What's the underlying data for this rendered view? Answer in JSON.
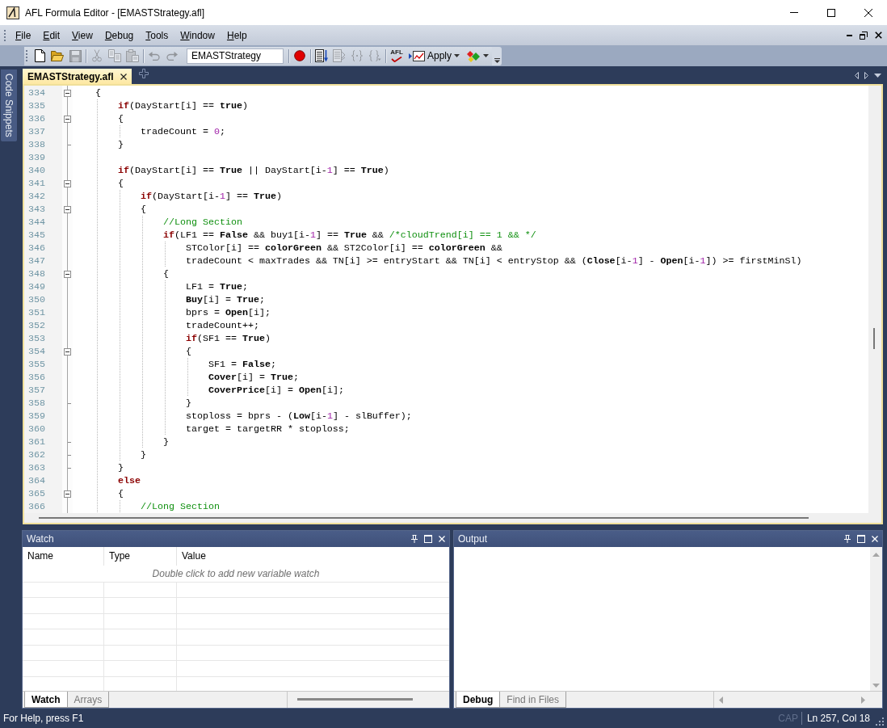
{
  "window": {
    "title": "AFL Formula Editor - [EMASTStrategy.afl]"
  },
  "menu": [
    {
      "label": "File"
    },
    {
      "label": "Edit"
    },
    {
      "label": "View"
    },
    {
      "label": "Debug"
    },
    {
      "label": "Tools"
    },
    {
      "label": "Window"
    },
    {
      "label": "Help"
    }
  ],
  "toolbar": {
    "items": [
      {
        "kind": "button",
        "disabled": false
      },
      {
        "kind": "button",
        "disabled": false
      },
      {
        "kind": "button",
        "disabled": true
      },
      {
        "kind": "separator"
      },
      {
        "kind": "button",
        "disabled": true
      },
      {
        "kind": "button",
        "disabled": true
      },
      {
        "kind": "button",
        "disabled": true
      },
      {
        "kind": "separator"
      },
      {
        "kind": "button",
        "disabled": true
      },
      {
        "kind": "button",
        "disabled": true
      },
      {
        "kind": "combo",
        "value": "EMASTStrategy"
      },
      {
        "kind": "separator"
      },
      {
        "kind": "button",
        "disabled": false
      },
      {
        "kind": "separator"
      },
      {
        "kind": "button",
        "disabled": false
      },
      {
        "kind": "button",
        "disabled": true
      },
      {
        "kind": "button",
        "disabled": true
      },
      {
        "kind": "button",
        "disabled": true
      },
      {
        "kind": "separator"
      },
      {
        "kind": "button",
        "label": "AFL",
        "disabled": false
      },
      {
        "kind": "split",
        "label": "Apply",
        "disabled": false
      },
      {
        "kind": "split",
        "disabled": false
      }
    ]
  },
  "side_tabs": [
    {
      "label": "Code Snippets"
    }
  ],
  "document_tabs": [
    {
      "label": "EMASTStrategy.afl",
      "selected": true
    }
  ],
  "editor": {
    "lines": [
      {
        "number": "334",
        "expanded": true,
        "tokens": [
          {
            "text": "{",
            "kind": "plain"
          }
        ],
        "children": [
          {
            "number": "335",
            "tokens": [
              {
                "text": "if",
                "kind": "keyword"
              },
              {
                "text": "(DayStart[i] == ",
                "kind": "plain"
              },
              {
                "text": "true",
                "kind": "builtin"
              },
              {
                "text": ")",
                "kind": "plain"
              }
            ]
          },
          {
            "number": "336",
            "expanded": true,
            "tokens": [
              {
                "text": "{",
                "kind": "plain"
              }
            ],
            "children": [
              {
                "number": "337",
                "tokens": [
                  {
                    "text": "tradeCount = ",
                    "kind": "plain"
                  },
                  {
                    "text": "0",
                    "kind": "number"
                  },
                  {
                    "text": ";",
                    "kind": "plain"
                  }
                ]
              }
            ]
          },
          {
            "number": "338",
            "fold_end": true,
            "tokens": [
              {
                "text": "}",
                "kind": "plain"
              }
            ]
          },
          {
            "number": "339"
          },
          {
            "number": "340",
            "tokens": [
              {
                "text": "if",
                "kind": "keyword"
              },
              {
                "text": "(DayStart[i] == ",
                "kind": "plain"
              },
              {
                "text": "True",
                "kind": "builtin"
              },
              {
                "text": " || DayStart[i-",
                "kind": "plain"
              },
              {
                "text": "1",
                "kind": "number"
              },
              {
                "text": "] == ",
                "kind": "plain"
              },
              {
                "text": "True",
                "kind": "builtin"
              },
              {
                "text": ")",
                "kind": "plain"
              }
            ]
          },
          {
            "number": "341",
            "expanded": true,
            "tokens": [
              {
                "text": "{",
                "kind": "plain"
              }
            ],
            "children": [
              {
                "number": "342",
                "tokens": [
                  {
                    "text": "if",
                    "kind": "keyword"
                  },
                  {
                    "text": "(DayStart[i-",
                    "kind": "plain"
                  },
                  {
                    "text": "1",
                    "kind": "number"
                  },
                  {
                    "text": "] == ",
                    "kind": "plain"
                  },
                  {
                    "text": "True",
                    "kind": "builtin"
                  },
                  {
                    "text": ")",
                    "kind": "plain"
                  }
                ]
              },
              {
                "number": "343",
                "expanded": true,
                "tokens": [
                  {
                    "text": "{",
                    "kind": "plain"
                  }
                ],
                "children": [
                  {
                    "number": "344",
                    "tokens": [
                      {
                        "text": "//Long Section",
                        "kind": "comment"
                      }
                    ]
                  },
                  {
                    "number": "345",
                    "tokens": [
                      {
                        "text": "if",
                        "kind": "keyword"
                      },
                      {
                        "text": "(LF1 == ",
                        "kind": "plain"
                      },
                      {
                        "text": "False",
                        "kind": "builtin"
                      },
                      {
                        "text": " && buy1[i-",
                        "kind": "plain"
                      },
                      {
                        "text": "1",
                        "kind": "number"
                      },
                      {
                        "text": "] == ",
                        "kind": "plain"
                      },
                      {
                        "text": "True",
                        "kind": "builtin"
                      },
                      {
                        "text": " && ",
                        "kind": "plain"
                      },
                      {
                        "text": "/*cloudTrend[i] == 1 && */",
                        "kind": "comment"
                      }
                    ],
                    "children": [
                      {
                        "number": "346",
                        "tokens": [
                          {
                            "text": "STColor[i] == ",
                            "kind": "plain"
                          },
                          {
                            "text": "colorGreen",
                            "kind": "builtin"
                          },
                          {
                            "text": " && ST2Color[i] == ",
                            "kind": "plain"
                          },
                          {
                            "text": "colorGreen",
                            "kind": "builtin"
                          },
                          {
                            "text": " &&",
                            "kind": "plain"
                          }
                        ]
                      },
                      {
                        "number": "347",
                        "tokens": [
                          {
                            "text": "tradeCount < maxTrades && TN[i] >= entryStart && TN[i] < entryStop && (",
                            "kind": "plain"
                          },
                          {
                            "text": "Close",
                            "kind": "builtin"
                          },
                          {
                            "text": "[i-",
                            "kind": "plain"
                          },
                          {
                            "text": "1",
                            "kind": "number"
                          },
                          {
                            "text": "] - ",
                            "kind": "plain"
                          },
                          {
                            "text": "Open",
                            "kind": "builtin"
                          },
                          {
                            "text": "[i-",
                            "kind": "plain"
                          },
                          {
                            "text": "1",
                            "kind": "number"
                          },
                          {
                            "text": "]) >= firstMinSl)",
                            "kind": "plain"
                          }
                        ]
                      }
                    ]
                  },
                  {
                    "number": "348",
                    "expanded": true,
                    "tokens": [
                      {
                        "text": "{",
                        "kind": "plain"
                      }
                    ],
                    "children": [
                      {
                        "number": "349",
                        "tokens": [
                          {
                            "text": "LF1 = ",
                            "kind": "plain"
                          },
                          {
                            "text": "True",
                            "kind": "builtin"
                          },
                          {
                            "text": ";",
                            "kind": "plain"
                          }
                        ]
                      },
                      {
                        "number": "350",
                        "tokens": [
                          {
                            "text": "Buy",
                            "kind": "builtin"
                          },
                          {
                            "text": "[i] = ",
                            "kind": "plain"
                          },
                          {
                            "text": "True",
                            "kind": "builtin"
                          },
                          {
                            "text": ";",
                            "kind": "plain"
                          }
                        ]
                      },
                      {
                        "number": "351",
                        "tokens": [
                          {
                            "text": "bprs = ",
                            "kind": "plain"
                          },
                          {
                            "text": "Open",
                            "kind": "builtin"
                          },
                          {
                            "text": "[i];",
                            "kind": "plain"
                          }
                        ]
                      },
                      {
                        "number": "352",
                        "tokens": [
                          {
                            "text": "tradeCount++;",
                            "kind": "plain"
                          }
                        ]
                      },
                      {
                        "number": "353",
                        "tokens": [
                          {
                            "text": "if",
                            "kind": "keyword"
                          },
                          {
                            "text": "(SF1 == ",
                            "kind": "plain"
                          },
                          {
                            "text": "True",
                            "kind": "builtin"
                          },
                          {
                            "text": ")",
                            "kind": "plain"
                          }
                        ]
                      },
                      {
                        "number": "354",
                        "expanded": true,
                        "tokens": [
                          {
                            "text": "{",
                            "kind": "plain"
                          }
                        ],
                        "children": [
                          {
                            "number": "355",
                            "tokens": [
                              {
                                "text": "SF1 = ",
                                "kind": "plain"
                              },
                              {
                                "text": "False",
                                "kind": "builtin"
                              },
                              {
                                "text": ";",
                                "kind": "plain"
                              }
                            ]
                          },
                          {
                            "number": "356",
                            "tokens": [
                              {
                                "text": "Cover",
                                "kind": "builtin"
                              },
                              {
                                "text": "[i] = ",
                                "kind": "plain"
                              },
                              {
                                "text": "True",
                                "kind": "builtin"
                              },
                              {
                                "text": ";",
                                "kind": "plain"
                              }
                            ]
                          },
                          {
                            "number": "357",
                            "tokens": [
                              {
                                "text": "CoverPrice",
                                "kind": "builtin"
                              },
                              {
                                "text": "[i] = ",
                                "kind": "plain"
                              },
                              {
                                "text": "Open",
                                "kind": "builtin"
                              },
                              {
                                "text": "[i];",
                                "kind": "plain"
                              }
                            ]
                          }
                        ]
                      },
                      {
                        "number": "358",
                        "fold_end": true,
                        "tokens": [
                          {
                            "text": "}",
                            "kind": "plain"
                          }
                        ]
                      },
                      {
                        "number": "359",
                        "tokens": [
                          {
                            "text": "stoploss = bprs - (",
                            "kind": "plain"
                          },
                          {
                            "text": "Low",
                            "kind": "builtin"
                          },
                          {
                            "text": "[i-",
                            "kind": "plain"
                          },
                          {
                            "text": "1",
                            "kind": "number"
                          },
                          {
                            "text": "] - slBuffer);",
                            "kind": "plain"
                          }
                        ]
                      },
                      {
                        "number": "360",
                        "tokens": [
                          {
                            "text": "target = targetRR * stoploss;",
                            "kind": "plain"
                          }
                        ]
                      }
                    ]
                  },
                  {
                    "number": "361",
                    "fold_end": true,
                    "tokens": [
                      {
                        "text": "}",
                        "kind": "plain"
                      }
                    ]
                  }
                ]
              },
              {
                "number": "362",
                "fold_end": true,
                "tokens": [
                  {
                    "text": "}",
                    "kind": "plain"
                  }
                ]
              }
            ]
          },
          {
            "number": "363",
            "fold_end": true,
            "tokens": [
              {
                "text": "}",
                "kind": "plain"
              }
            ]
          },
          {
            "number": "364",
            "tokens": [
              {
                "text": "else",
                "kind": "keyword"
              }
            ]
          },
          {
            "number": "365",
            "expanded": true,
            "tokens": [
              {
                "text": "{",
                "kind": "plain"
              }
            ],
            "children": [
              {
                "number": "366",
                "tokens": [
                  {
                    "text": "//Long Section",
                    "kind": "comment"
                  }
                ]
              }
            ]
          }
        ]
      }
    ]
  },
  "watch_panel": {
    "title": "Watch",
    "columns": [
      "Name",
      "Type",
      "Value"
    ],
    "hint": "Double click to add new variable watch",
    "tabs": [
      {
        "label": "Watch",
        "selected": true
      },
      {
        "label": "Arrays",
        "selected": false
      }
    ]
  },
  "output_panel": {
    "title": "Output",
    "tabs": [
      {
        "label": "Debug",
        "selected": true
      },
      {
        "label": "Find in Files",
        "selected": false
      }
    ]
  },
  "status_bar": {
    "message": "For Help, press F1",
    "indicators": [
      {
        "label": "CAP",
        "active": false
      }
    ],
    "position": "Ln 257, Col 18"
  }
}
